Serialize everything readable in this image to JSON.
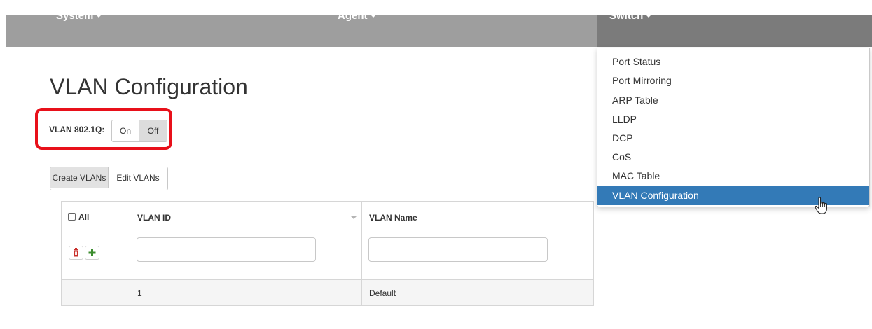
{
  "nav": {
    "system": "System",
    "agent": "Agent",
    "switch": "Switch"
  },
  "switch_menu": {
    "items": [
      "Port Status",
      "Port Mirroring",
      "ARP Table",
      "LLDP",
      "DCP",
      "CoS",
      "MAC Table",
      "VLAN Configuration"
    ],
    "active": "VLAN Configuration"
  },
  "page": {
    "title": "VLAN Configuration"
  },
  "vlan_8021q": {
    "label": "VLAN 802.1Q:",
    "on_label": "On",
    "off_label": "Off",
    "selected": "Off"
  },
  "tabs": {
    "create": "Create VLANs",
    "edit": "Edit VLANs"
  },
  "table": {
    "all_label": "All",
    "col_vlan_id": "VLAN ID",
    "col_vlan_name": "VLAN Name",
    "new_vlan_id": "",
    "new_vlan_name": "",
    "rows": [
      {
        "vlan_id": "1",
        "vlan_name": "Default"
      }
    ]
  },
  "colors": {
    "navbar": "#9e9e9e",
    "navbar_active": "#7b7b7b",
    "menu_active": "#337ab7",
    "highlight": "#e8101a",
    "delete_icon": "#c9302c",
    "add_icon": "#3c8d2f"
  },
  "icons": {
    "delete": "trash-icon",
    "add": "plus-icon",
    "cursor": "hand-pointer-icon"
  }
}
